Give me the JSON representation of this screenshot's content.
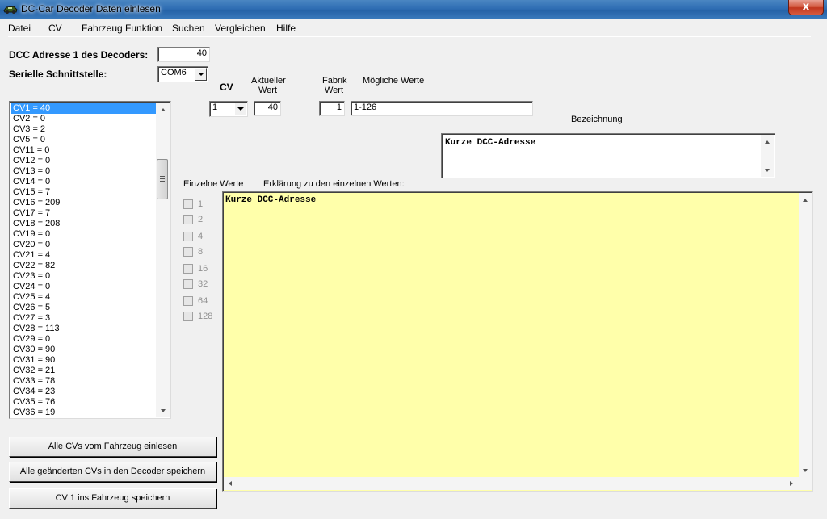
{
  "window": {
    "title": "DC-Car Decoder Daten einlesen",
    "close_label": "x"
  },
  "menu": [
    "Datei",
    "CV",
    "Fahrzeug Funktion",
    "Suchen",
    "Vergleichen",
    "Hilfe"
  ],
  "dcc_address": {
    "label": "DCC Adresse 1 des Decoders:",
    "value": "40"
  },
  "serial": {
    "label": "Serielle Schnittstelle:",
    "value": "COM6"
  },
  "cv_list": [
    "CV1  = 40",
    "CV2  = 0",
    "CV3  = 2",
    "CV5  = 0",
    "CV11 = 0",
    "CV12 = 0",
    "CV13 = 0",
    "CV14 = 0",
    "CV15 = 7",
    "CV16 = 209",
    "CV17 = 7",
    "CV18 = 208",
    "CV19 = 0",
    "CV20 = 0",
    "CV21 = 4",
    "CV22 = 82",
    "CV23 = 0",
    "CV24 = 0",
    "CV25 = 4",
    "CV26 = 5",
    "CV27 = 3",
    "CV28 = 113",
    "CV29 = 0",
    "CV30 = 90",
    "CV31 = 90",
    "CV32 = 21",
    "CV33 = 78",
    "CV34 = 23",
    "CV35 = 76",
    "CV36 = 19"
  ],
  "cv_selector": {
    "label": "CV",
    "value": "1"
  },
  "current_value": {
    "label_line1": "Aktueller",
    "label_line2": "Wert",
    "value": "40"
  },
  "factory_value": {
    "label_line1": "Fabrik",
    "label_line2": "Wert",
    "value": "1"
  },
  "possible_values": {
    "label": "Mögliche Werte",
    "value": "1-126"
  },
  "designation": {
    "label": "Bezeichnung",
    "value": "Kurze DCC-Adresse"
  },
  "single_values": {
    "label": "Einzelne Werte",
    "bits": [
      "1",
      "2",
      "4",
      "8",
      "16",
      "32",
      "64",
      "128"
    ]
  },
  "explanation": {
    "label": "Erklärung zu den einzelnen Werten:",
    "value": "Kurze DCC-Adresse"
  },
  "buttons": {
    "read_all": "Alle CVs vom Fahrzeug einlesen",
    "save_changed": "Alle geänderten CVs in den Decoder speichern",
    "save_cv1": "CV 1 ins Fahrzeug speichern"
  },
  "colors": {
    "selection": "#3399ff",
    "explanation_bg": "#ffffaa",
    "titlebar": "#2e6db3"
  }
}
